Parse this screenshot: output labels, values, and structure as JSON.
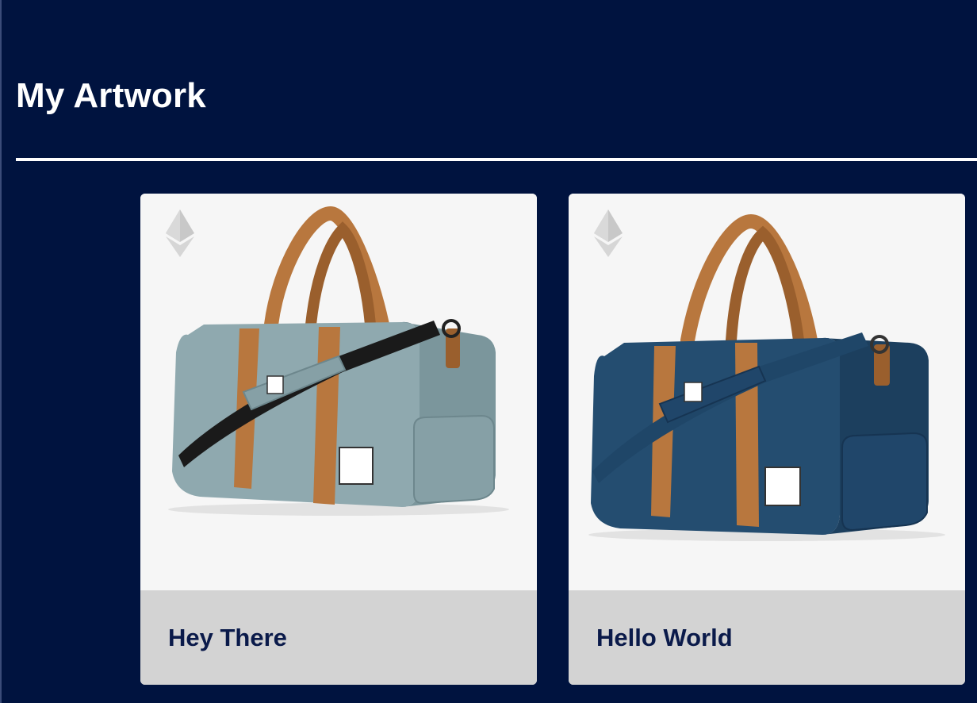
{
  "page": {
    "title": "My Artwork"
  },
  "colors": {
    "background": "#00133f",
    "card_image_bg": "#f6f6f6",
    "card_footer_bg": "#d3d3d3",
    "card_title": "#0a1a4a"
  },
  "artworks": [
    {
      "title": "Hey There",
      "currency_icon": "ethereum-icon",
      "image": "duffel-bag-sage",
      "bag_color": "#8fa9af",
      "bag_shade": "#7b969c"
    },
    {
      "title": "Hello World",
      "currency_icon": "ethereum-icon",
      "image": "duffel-bag-navy",
      "bag_color": "#244d70",
      "bag_shade": "#1c3f5e"
    }
  ]
}
